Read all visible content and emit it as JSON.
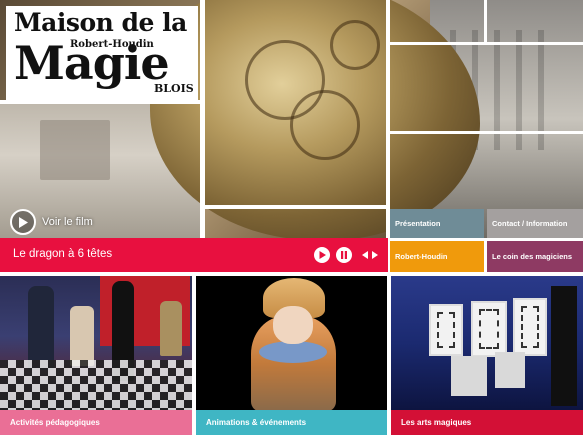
{
  "logo": {
    "line1": "Maison de la",
    "line2": "Robert-Houdin",
    "line3": "Magie",
    "line4": "BLOIS"
  },
  "hero": {
    "film_label": "Voir le film",
    "caption": "Le dragon à 6 têtes",
    "controls": {
      "play_icon": "play-icon",
      "pause_icon": "pause-icon",
      "prev_icon": "prev-arrow-icon",
      "next_icon": "next-arrow-icon"
    }
  },
  "nav": {
    "tiles": [
      {
        "label": "Présentation",
        "color": "#6f8c97"
      },
      {
        "label": "Contact / Information",
        "color": "#a4a09f"
      },
      {
        "label": "Robert-Houdin",
        "color": "#f09a0c"
      },
      {
        "label": "Le coin des magiciens",
        "color": "#8e3a63"
      }
    ]
  },
  "panels": [
    {
      "label": "Activités pédagogiques",
      "color": "#ea6f96"
    },
    {
      "label": "Animations & événements",
      "color": "#3fb6c4"
    },
    {
      "label": "Les arts magiques",
      "color": "#d31036"
    }
  ],
  "colors": {
    "caption_bar": "#e8103f"
  }
}
